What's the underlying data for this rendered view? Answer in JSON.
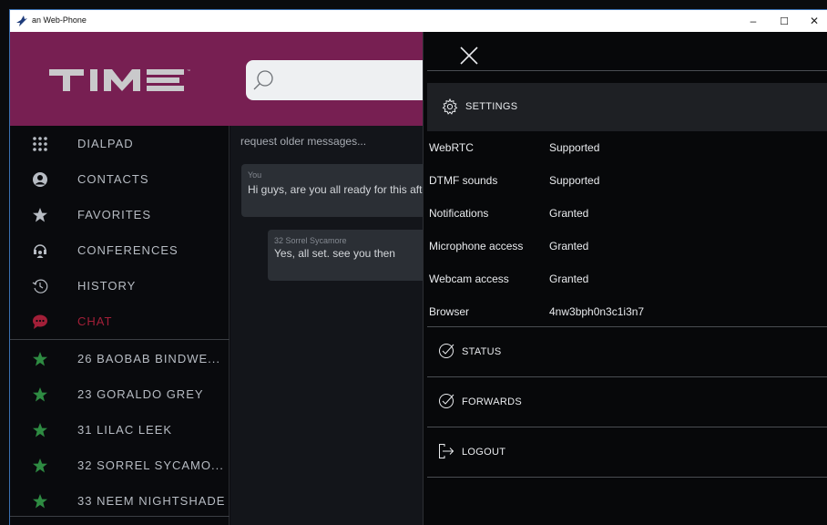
{
  "window": {
    "title": "an Web-Phone",
    "minimize": "–",
    "maximize": "☐",
    "close": "✕"
  },
  "brand": {
    "logo_text": "TIME",
    "search": {
      "placeholder": ""
    }
  },
  "sidebar": {
    "nav": [
      {
        "label": "DIALPAD",
        "icon": "dialpad-icon"
      },
      {
        "label": "CONTACTS",
        "icon": "contact-icon"
      },
      {
        "label": "FAVORITES",
        "icon": "star-icon"
      },
      {
        "label": "CONFERENCES",
        "icon": "conference-icon"
      },
      {
        "label": "HISTORY",
        "icon": "history-icon"
      },
      {
        "label": "CHAT",
        "icon": "chat-icon"
      }
    ],
    "favorites": [
      {
        "label": "26 BAOBAB BINDWE..."
      },
      {
        "label": "23 GORALDO GREY"
      },
      {
        "label": "31 LILAC LEEK"
      },
      {
        "label": "32 SORREL SYCAMO..."
      },
      {
        "label": "33 NEEM NIGHTSHADE"
      }
    ],
    "colors": {
      "active": "#a21f38",
      "favorite_star": "#2e8b42"
    }
  },
  "chat": {
    "older_link": "request older messages...",
    "messages": [
      {
        "author": "You",
        "text": "Hi guys, are you all ready for this afte"
      },
      {
        "author": "32 Sorrel Sycamore",
        "text": "Yes, all set. see you then"
      }
    ]
  },
  "panel": {
    "settings_label": "SETTINGS",
    "rows": [
      {
        "label": "WebRTC",
        "value": "Supported"
      },
      {
        "label": "DTMF sounds",
        "value": "Supported"
      },
      {
        "label": "Notifications",
        "value": "Granted"
      },
      {
        "label": "Microphone access",
        "value": "Granted"
      },
      {
        "label": "Webcam access",
        "value": "Granted"
      },
      {
        "label": "Browser",
        "value": "4nw3bph0n3c1i3n7"
      }
    ],
    "status_label": "STATUS",
    "forwards_label": "FORWARDS",
    "logout_label": "LOGOUT"
  }
}
